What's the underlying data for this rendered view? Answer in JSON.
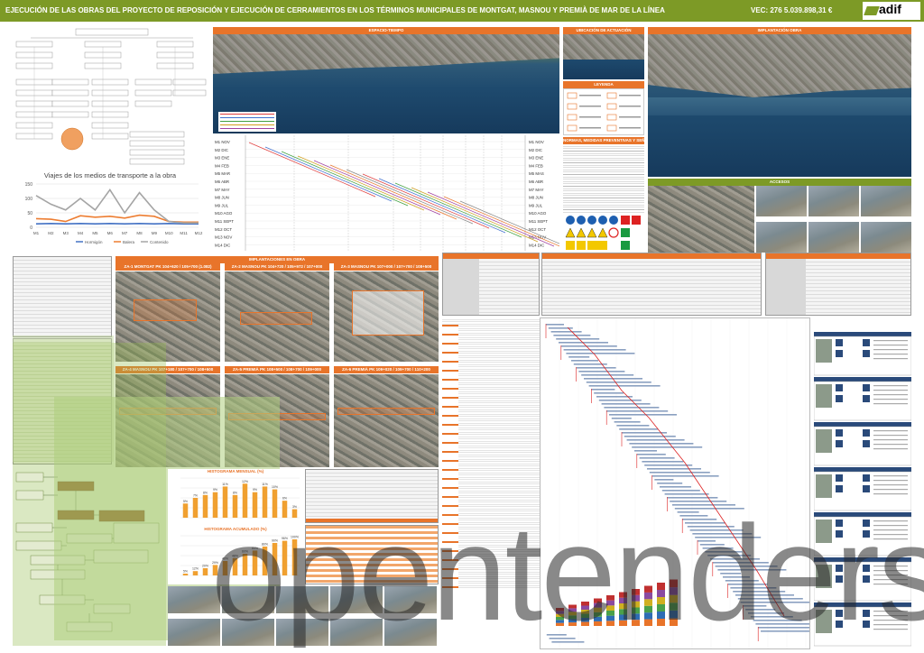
{
  "header": {
    "title": "EJECUCIÓN DE LAS OBRAS DEL PROYECTO DE REPOSICIÓN Y EJECUCIÓN DE CERRAMIENTOS EN LOS TÉRMINOS MUNICIPALES DE MONTGAT, MASNOU Y PREMIÀ DE MAR DE LA LÍNEA",
    "budget": "VEC: 276 5.039.898,31 €",
    "logo_text": "adif",
    "color": "#7d9a26"
  },
  "panels": {
    "espacio_tiempo": "ESPACIO-TIEMPO",
    "ubicacion": "UBICACIÓN DE ACTUACIÓN",
    "leyenda": "LEYENDA",
    "normas": "NORMAS, MEDIDAS PREVENTIVAS Y SEÑALIZACIÓN",
    "implantacion": "IMPLANTACIÓN OBRA",
    "accesos": "ACCESOS",
    "implantaciones": "IMPLANTACIONES EN OBRA",
    "histograma_mensual": "HISTOGRAMA MENSUAL (%)",
    "histograma_acumulado": "HISTOGRAMA ACUMULADO (%)"
  },
  "months_left": [
    "M1 NOV",
    "M2 DIC",
    "M3 ENE",
    "M4 FEB",
    "M5 MAR",
    "M6 ABR",
    "M7 MAY",
    "M8 JUN",
    "M9 JUL",
    "M10 AGO",
    "M11 SEPT",
    "M12 OCT",
    "M13 NOV",
    "M14 DIC"
  ],
  "months_right": [
    "M1 NOV",
    "M2 DIC",
    "M3 ENE",
    "M4 FEB",
    "M5 MAS",
    "M6 ABR",
    "M7 MAY",
    "M8 JUN",
    "M9 JUL",
    "M10 AGO",
    "M11 SEPT",
    "M12 OCT",
    "M13 NOV",
    "M14 DIC"
  ],
  "zones": [
    "ZA-1 MONTGAT PK 104+620 / 105+700 (1.082)",
    "ZA-2 MASNOU PK 104+720 / 105+972 / 107+000",
    "ZA-3 MASNOU PK 107+000 / 107+700 / 108+500",
    "ZA-4 MASNOU PK 107+180 / 107+700 / 108+500",
    "ZA-5 PREMIÀ PK 108+500 / 108+700 / 109+000",
    "ZA-6 PREMIÀ PK 109+020 / 109+700 / 110+200"
  ],
  "watermark": "opentenders",
  "chart_data": [
    {
      "type": "line",
      "title": "Viajes de los medios de transporte a la obra",
      "categories": [
        "M1",
        "M2",
        "M3",
        "M4",
        "M5",
        "M6",
        "M7",
        "M8",
        "M9",
        "M10",
        "M11",
        "M12"
      ],
      "series": [
        {
          "name": "Hormigón",
          "values": [
            12,
            13,
            12,
            13,
            12,
            13,
            12,
            13,
            12,
            13,
            12,
            12
          ],
          "color": "#4472c4"
        },
        {
          "name": "Balera",
          "values": [
            30,
            28,
            20,
            40,
            35,
            38,
            32,
            42,
            38,
            20,
            18,
            18
          ],
          "color": "#ed7d31"
        },
        {
          "name": "Contenido",
          "values": [
            110,
            80,
            60,
            100,
            60,
            130,
            50,
            120,
            60,
            20,
            15,
            15
          ],
          "color": "#a5a5a5"
        }
      ],
      "yticks": [
        0,
        50,
        100,
        150
      ],
      "ylim": [
        0,
        150
      ]
    },
    {
      "type": "bar",
      "title": "HISTOGRAMA MENSUAL (%)",
      "values": [
        5,
        7,
        8,
        9,
        11,
        8,
        12,
        9,
        11,
        10,
        6,
        3
      ],
      "color": "#f0a030",
      "ylim": [
        0,
        14
      ]
    },
    {
      "type": "bar",
      "title": "HISTOGRAMA ACUMULADO (%)",
      "values": [
        5,
        12,
        20,
        29,
        40,
        48,
        60,
        69,
        80,
        90,
        96,
        100
      ],
      "color": "#f0a030",
      "ylim": [
        0,
        110
      ]
    }
  ]
}
